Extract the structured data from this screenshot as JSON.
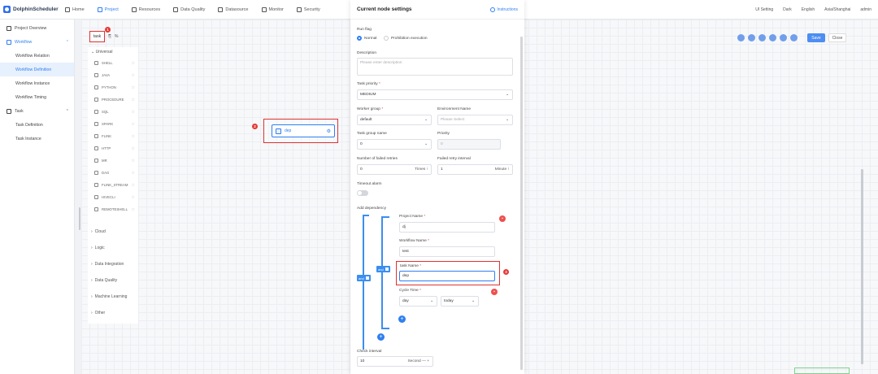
{
  "app": {
    "name": "DolphinScheduler"
  },
  "nav": [
    {
      "label": "Home"
    },
    {
      "label": "Project"
    },
    {
      "label": "Resources"
    },
    {
      "label": "Data Quality"
    },
    {
      "label": "Datasource"
    },
    {
      "label": "Monitor"
    },
    {
      "label": "Security"
    }
  ],
  "header_right": {
    "ui_setting": "UI Setting",
    "theme": "Dark",
    "language": "English",
    "timezone": "Asia/Shanghai",
    "user": "admin"
  },
  "sidebar": {
    "items": [
      {
        "label": "Project Overview"
      },
      {
        "label": "Workflow"
      },
      {
        "label": "Workflow Relation"
      },
      {
        "label": "Workflow Definition"
      },
      {
        "label": "Workflow Instance"
      },
      {
        "label": "Workflow Timing"
      },
      {
        "label": "Task"
      },
      {
        "label": "Task Definition"
      },
      {
        "label": "Task Instance"
      }
    ]
  },
  "canvas_tabs": {
    "task": "task",
    "badge1": "1"
  },
  "toolpanel": {
    "universal": "Universal",
    "tasks": [
      "SHELL",
      "JAVA",
      "PYTHON",
      "PROCEDURE",
      "SQL",
      "SPARK",
      "FLINK",
      "HTTP",
      "MR",
      "DAG",
      "FLINK_STREAM",
      "HIVECLI",
      "REMOTESHELL"
    ],
    "categories": [
      "Cloud",
      "Logic",
      "Data Integration",
      "Data Quality",
      "Machine Learning",
      "Other"
    ]
  },
  "node": {
    "label": "dep",
    "badge": "2"
  },
  "toolbar": {
    "save": "Save",
    "close": "Close"
  },
  "drawer": {
    "title": "Current node settings",
    "instructions": "Instructions",
    "run_flag": {
      "label": "Run flag",
      "normal": "Normal",
      "prohibit": "Prohibition execution"
    },
    "description": {
      "label": "Description",
      "placeholder": "Please enter description"
    },
    "task_priority": {
      "label": "Task priority",
      "value": "MEDIUM"
    },
    "worker_group": {
      "label": "Worker group",
      "value": "default"
    },
    "environment": {
      "label": "Environment Name",
      "placeholder": "Please Select"
    },
    "task_group": {
      "label": "Task group name",
      "value": "0"
    },
    "priority": {
      "label": "Priority",
      "value": "0"
    },
    "failed_retries": {
      "label": "Number of failed retries",
      "value": "0",
      "unit": "Times"
    },
    "retry_interval": {
      "label": "Failed retry interval",
      "value": "1",
      "unit": "Minute"
    },
    "timeout_alarm": {
      "label": "Timeout alarm"
    },
    "dependency": {
      "label": "Add dependency",
      "and_outer": "and",
      "and_inner": "and",
      "project_name": {
        "label": "Project Name",
        "value": "dj"
      },
      "workflow_name": {
        "label": "Workflow Name",
        "value": "test"
      },
      "task_name": {
        "label": "task Name",
        "value": "dep"
      },
      "cycle_time": {
        "label": "Cycle Time",
        "cycle": "day",
        "date": "today"
      },
      "badge": "3"
    },
    "check_interval": {
      "label": "Check interval",
      "value": "10",
      "unit": "Second"
    }
  }
}
